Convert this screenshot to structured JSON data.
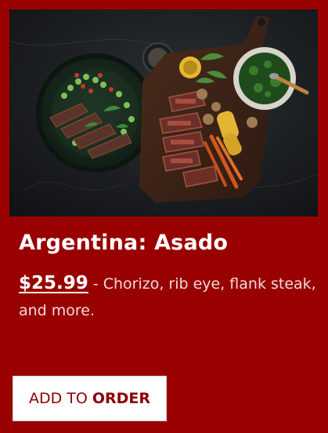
{
  "card": {
    "image_subject": "Grilled steak, vegetables and chimichurri on a dark stone surface",
    "title": "Argentina: Asado",
    "price": "$25.99",
    "description": " - Chorizo, rib eye, flank steak, and more.",
    "button_text": "ADD TO",
    "button_bold": "ORDER"
  },
  "colors": {
    "card_background": "#990000",
    "title_text": "#ffffff",
    "description_text": "#f1dada",
    "button_background": "#ffffff",
    "button_text": "#8c0000"
  }
}
